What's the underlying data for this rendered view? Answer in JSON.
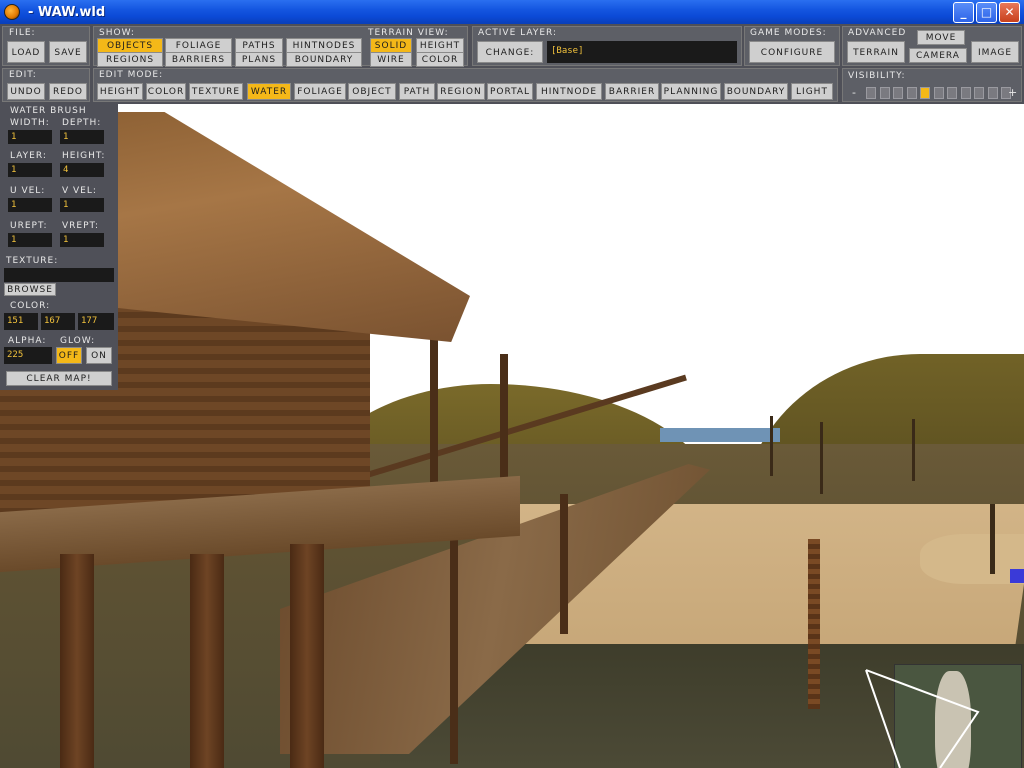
{
  "window": {
    "title": "- WAW.wld"
  },
  "file": {
    "label": "File:",
    "load": "Load",
    "save": "Save"
  },
  "show": {
    "label": "Show:",
    "buttons": [
      "Objects",
      "Foliage",
      "Paths",
      "HintNodes",
      "Regions",
      "Barriers",
      "Plans",
      "Boundary"
    ],
    "active": "Objects"
  },
  "terrain_view": {
    "label": "Terrain View:",
    "buttons": [
      "Solid",
      "Height",
      "Wire",
      "Color"
    ],
    "active": "Solid"
  },
  "active_layer": {
    "label": "Active Layer:",
    "change": "Change:",
    "value": "[Base]"
  },
  "game_modes": {
    "label": "Game Modes:",
    "configure": "Configure"
  },
  "advanced": {
    "label": "Advanced",
    "terrain": "Terrain",
    "move": "Move",
    "camera": "Camera",
    "image": "Image"
  },
  "edit": {
    "label": "Edit:",
    "undo": "Undo",
    "redo": "Redo"
  },
  "edit_mode": {
    "label": "Edit Mode:",
    "buttons": [
      "Height",
      "Color",
      "Texture",
      "Water",
      "Foliage",
      "Object",
      "Path",
      "Region",
      "Portal",
      "HintNode",
      "Barrier",
      "Planning",
      "Boundary",
      "Light"
    ],
    "active": "Water"
  },
  "visibility": {
    "label": "Visibility:",
    "minus": "-",
    "plus": "+",
    "levels": 11,
    "selected_level": 5
  },
  "water_brush": {
    "title": "Water Brush",
    "width_label": "Width:",
    "width": "1",
    "depth_label": "Depth:",
    "depth": "1",
    "layer_label": "Layer:",
    "layer": "1",
    "height_label": "Height:",
    "height": "4",
    "uvel_label": "U Vel:",
    "uvel": "1",
    "vvel_label": "V Vel:",
    "vvel": "1",
    "urept_label": "URept:",
    "urept": "1",
    "vrept_label": "VRept:",
    "vrept": "1",
    "texture_label": "Texture:",
    "texture": "",
    "browse": "Browse",
    "color_label": "Color:",
    "color_r": "151",
    "color_g": "167",
    "color_b": "177",
    "alpha_label": "Alpha:",
    "alpha": "225",
    "glow_label": "Glow:",
    "glow_off": "Off",
    "glow_on": "On",
    "glow_active": "Off",
    "clear_map": "Clear Map!"
  },
  "colors": {
    "accent": "#f4b818",
    "panel": "#4f5058",
    "field": "#1a1a1a",
    "field_text": "#f2c23c"
  }
}
